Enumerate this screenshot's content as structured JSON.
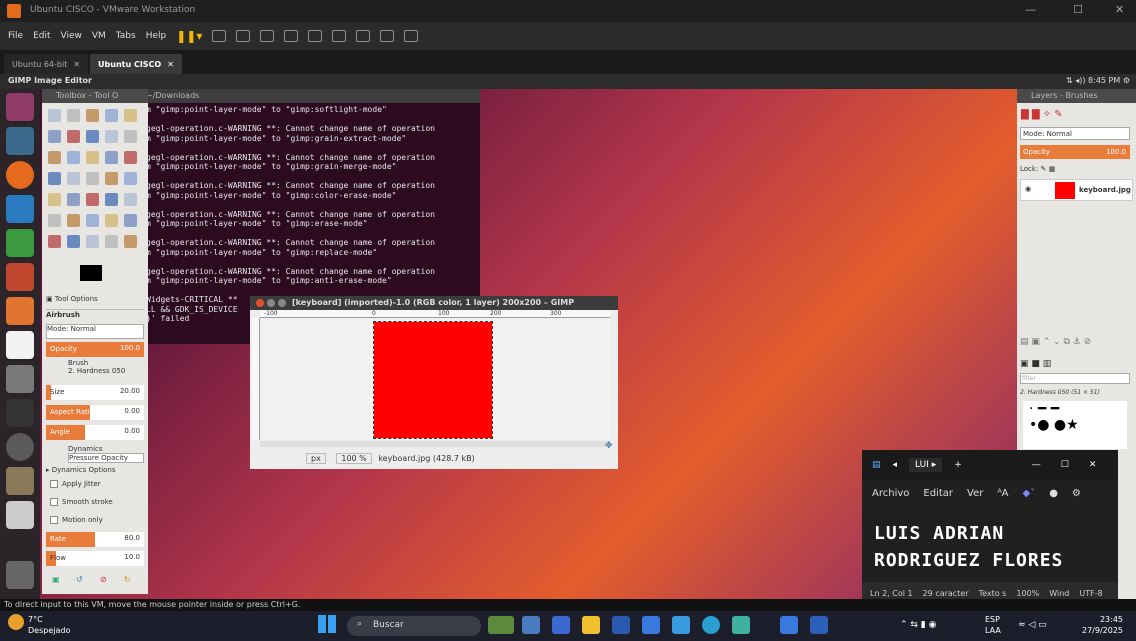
{
  "vm": {
    "title": "Ubuntu CISCO - VMware Workstation",
    "menu": [
      "File",
      "Edit",
      "View",
      "VM",
      "Tabs",
      "Help"
    ],
    "tabs": [
      "Ubuntu 64-bit",
      "Ubuntu CISCO"
    ],
    "status": "To direct input to this VM, move the mouse pointer inside or press Ctrl+G."
  },
  "ubuntu": {
    "app_title": "GIMP Image Editor",
    "clock": "8:45 PM"
  },
  "terminal": {
    "title": "~/Downloads",
    "lines": [
      "m \"gimp:point-layer-mode\" to \"gimp:softlight-mode\"",
      "",
      "gegl-operation.c-WARNING **: Cannot change name of operation",
      "m \"gimp:point-layer-mode\" to \"gimp:grain-extract-mode\"",
      "",
      "gegl-operation.c-WARNING **: Cannot change name of operation",
      "m \"gimp:point-layer-mode\" to \"gimp:grain-merge-mode\"",
      "",
      "gegl-operation.c-WARNING **: Cannot change name of operation",
      "m \"gimp:point-layer-mode\" to \"gimp:color-erase-mode\"",
      "",
      "gegl-operation.c-WARNING **: Cannot change name of operation",
      "m \"gimp:point-layer-mode\" to \"gimp:erase-mode\"",
      "",
      "gegl-operation.c-WARNING **: Cannot change name of operation",
      "m \"gimp:point-layer-mode\" to \"gimp:replace-mode\"",
      "",
      "gegl-operation.c-WARNING **: Cannot change name of operation",
      "m \"gimp:point-layer-mode\" to \"gimp:anti-erase-mode\""
    ],
    "tail": [
      "Widgets-CRITICAL **",
      "LL && GDK_IS_DEVICE",
      "}' failed"
    ]
  },
  "toolbox": {
    "title": "Toolbox - Tool O",
    "options_tab": "Tool Options",
    "tool_name": "Airbrush",
    "mode": "Mode: Normal",
    "opacity_label": "Opacity",
    "opacity_value": "100.0",
    "brush_label": "Brush",
    "brush_name": "2. Hardness 050",
    "size_label": "Size",
    "size_value": "20.00",
    "aspect_label": "Aspect Ratio",
    "aspect_value": "0.00",
    "angle_label": "Angle",
    "angle_value": "0.00",
    "dynamics_label": "Dynamics",
    "dynamics_value": "Pressure Opacity",
    "dynamics_options": "Dynamics Options",
    "apply_jitter": "Apply Jitter",
    "smooth_stroke": "Smooth stroke",
    "motion_only": "Motion only",
    "rate_label": "Rate",
    "rate_value": "80.0",
    "flow_label": "Flow",
    "flow_value": "10.0"
  },
  "image_window": {
    "title": "[keyboard] (imported)-1.0 (RGB color, 1 layer) 200x200 – GIMP",
    "unit": "px",
    "zoom": "100 %",
    "file_info": "keyboard.jpg (428.7 kB)",
    "ruler_ticks": [
      "-100",
      "0",
      "100",
      "200",
      "300"
    ]
  },
  "layers": {
    "title": "Layers - Brushes",
    "mode": "Mode: Normal",
    "opacity_label": "Opacity",
    "opacity_value": "100.0",
    "lock_label": "Lock:",
    "layer_name": "keyboard.jpg",
    "brush_filter": "filter",
    "brush_name": "2. Hardness 050 (51 × 51)"
  },
  "notepad": {
    "tab": "LUI",
    "menu": [
      "Archivo",
      "Editar",
      "Ver"
    ],
    "line1": "LUIS ADRIAN",
    "line2": "RODRIGUEZ FLORES",
    "status": [
      "Ln 2, Col 1",
      "29 caracter",
      "Texto s",
      "100%",
      "Wind",
      "UTF-8"
    ]
  },
  "taskbar": {
    "weather_temp": "7°C",
    "weather_desc": "Despejado",
    "search": "Buscar",
    "lang1": "ESP",
    "lang2": "LAA",
    "time": "23:45",
    "date": "27/9/2025"
  }
}
